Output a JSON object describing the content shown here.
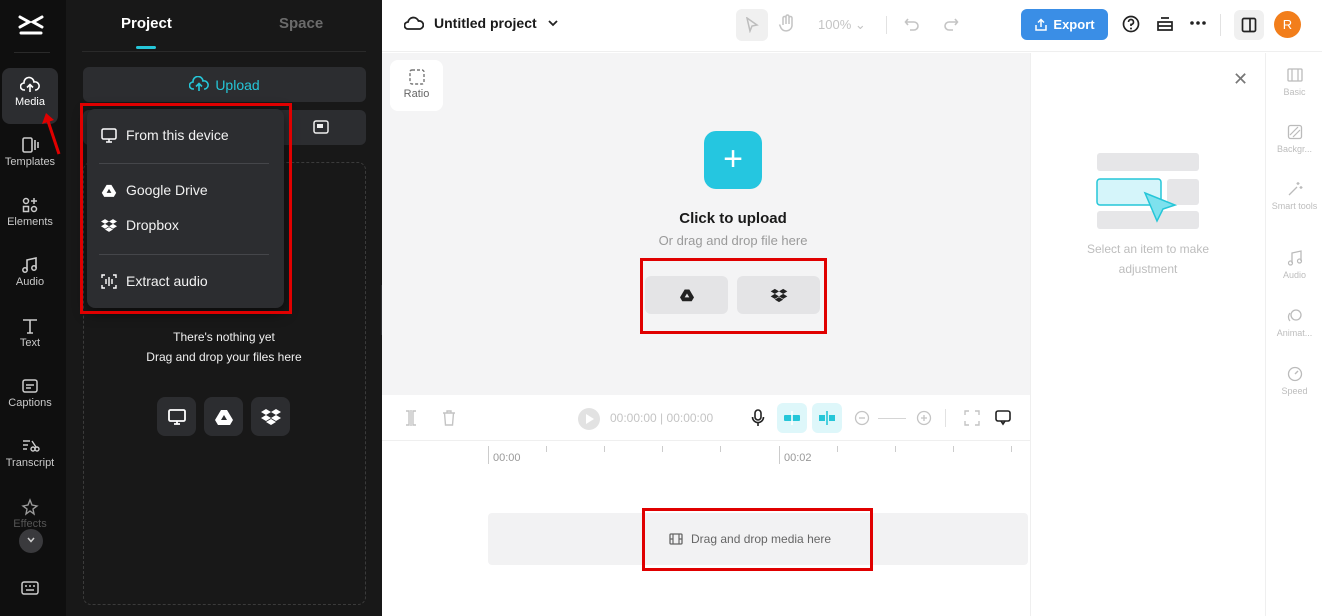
{
  "left_rail": {
    "items": [
      {
        "label": "Media",
        "icon": "cloud-upload-icon"
      },
      {
        "label": "Templates",
        "icon": "templates-icon"
      },
      {
        "label": "Elements",
        "icon": "elements-icon"
      },
      {
        "label": "Audio",
        "icon": "music-note-icon"
      },
      {
        "label": "Text",
        "icon": "text-icon"
      },
      {
        "label": "Captions",
        "icon": "captions-icon"
      },
      {
        "label": "Transcript",
        "icon": "transcript-icon"
      },
      {
        "label": "Effects",
        "icon": "effects-icon"
      }
    ]
  },
  "media_panel": {
    "tabs": [
      "Project",
      "Space"
    ],
    "upload_label": "Upload",
    "dropdown": {
      "items": [
        "From this device",
        "Google Drive",
        "Dropbox",
        "Extract audio"
      ]
    },
    "empty_title": "There's nothing yet",
    "empty_subtitle": "Drag and drop your files here"
  },
  "topbar": {
    "project_name": "Untitled project",
    "zoom": "100%",
    "export_label": "Export",
    "avatar_initial": "R"
  },
  "canvas": {
    "ratio_label": "Ratio",
    "upload_title": "Click to upload",
    "upload_subtitle": "Or drag and drop file here"
  },
  "timeline": {
    "current_time": "00:00:00",
    "total_time": "00:00:00",
    "ruler_labels": [
      "00:00",
      "00:02"
    ],
    "drop_label": "Drag and drop media here"
  },
  "right_panel": {
    "hint": "Select an item to make adjustment",
    "rail": [
      "Basic",
      "Backgr...",
      "Smart tools",
      "Audio",
      "Animat...",
      "Speed"
    ]
  },
  "colors": {
    "accent": "#25c6d8",
    "export": "#3a8ee6",
    "avatar": "#f27e1b",
    "highlight": "#e00000"
  }
}
